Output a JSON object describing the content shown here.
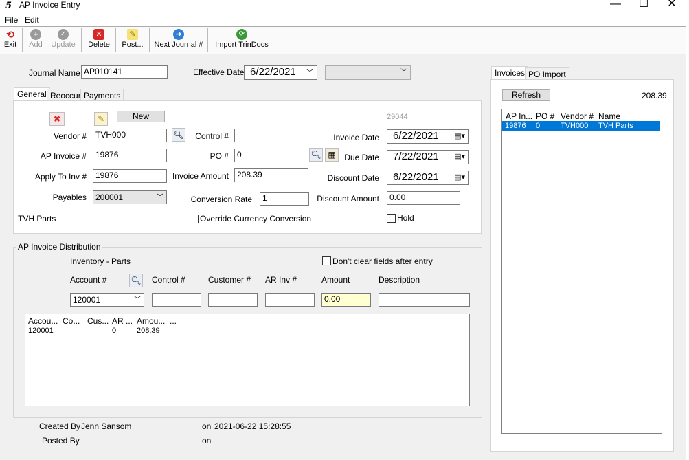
{
  "window": {
    "title": "AP Invoice Entry",
    "logo": "5",
    "min": "—",
    "max": "☐",
    "close": "✕"
  },
  "menu": [
    "File",
    "Edit"
  ],
  "toolbar": {
    "exit": "Exit",
    "add": "Add",
    "update": "Update",
    "delete": "Delete",
    "post": "Post...",
    "next_journal": "Next Journal #",
    "import_trindocs": "Import TrinDocs"
  },
  "journal": {
    "label": "Journal Name",
    "value": "AP010141",
    "eff_label": "Effective Date",
    "eff_date": "6/22/2021"
  },
  "tabs": [
    "General",
    "Reoccur",
    "Payments"
  ],
  "general": {
    "new_label": "New",
    "record_id": "29044",
    "vendor_label": "Vendor #",
    "vendor": "TVH000",
    "control_label": "Control #",
    "control": "",
    "invoice_date_label": "Invoice Date",
    "invoice_date": "6/22/2021",
    "ap_invoice_label": "AP Invoice #",
    "ap_invoice": "19876",
    "po_label": "PO #",
    "po": "0",
    "due_date_label": "Due Date",
    "due_date": "7/22/2021",
    "apply_label": "Apply To Inv #",
    "apply": "19876",
    "inv_amount_label": "Invoice Amount",
    "inv_amount": "208.39",
    "discount_date_label": "Discount Date",
    "discount_date": "6/22/2021",
    "payables_label": "Payables",
    "payables": "200001",
    "conv_label": "Conversion Rate",
    "conv": "1",
    "disc_amount_label": "Discount Amount",
    "disc_amount": "0.00",
    "vendor_name": "TVH Parts",
    "override_label": "Override Currency Conversion",
    "hold_label": "Hold"
  },
  "distribution": {
    "title": "AP Invoice Distribution",
    "subtitle": "Inventory - Parts",
    "dont_clear_label": "Don't clear fields after entry",
    "account_label": "Account #",
    "control_label": "Control #",
    "customer_label": "Customer #",
    "ar_inv_label": "AR Inv #",
    "amount_label": "Amount",
    "description_label": "Description",
    "account": "120001",
    "control": "",
    "customer": "",
    "ar_inv": "",
    "amount": "0.00",
    "description": "",
    "columns": [
      "Accou...",
      "Co...",
      "Cus...",
      "AR ...",
      "Amou...",
      "..."
    ],
    "rows": [
      [
        "120001",
        "",
        "",
        "0",
        "208.39",
        ""
      ]
    ]
  },
  "footer": {
    "created_label": "Created By",
    "created_by": "Jenn Sansom",
    "on_label": "on",
    "created_on": "2021-06-22 15:28:55",
    "posted_label": "Posted By",
    "posted_by": "",
    "posted_on_label": "on",
    "posted_on": ""
  },
  "right": {
    "tabs": [
      "Invoices",
      "PO Import"
    ],
    "refresh": "Refresh",
    "total": "208.39",
    "columns": [
      "AP In...",
      "PO #",
      "Vendor #",
      "Name"
    ],
    "rows": [
      [
        "19876",
        "0",
        "TVH000",
        "TVH Parts"
      ]
    ],
    "selected_color": "#0078d7"
  }
}
